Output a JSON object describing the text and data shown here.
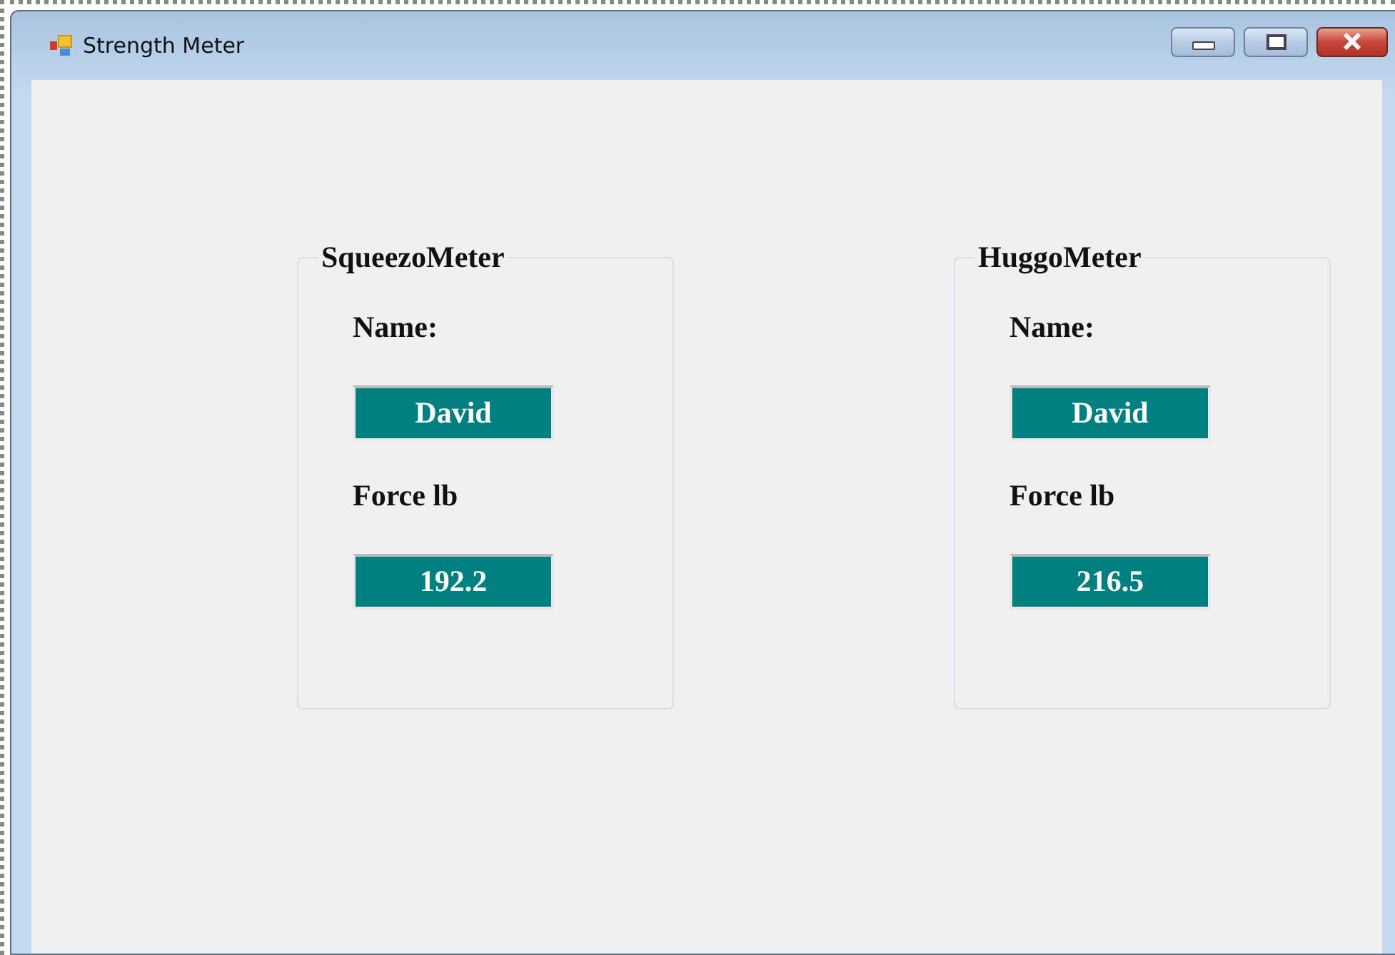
{
  "window": {
    "title": "Strength Meter"
  },
  "groups": [
    {
      "title": "SqueezoMeter",
      "name_label": "Name:",
      "name_value": "David",
      "force_label": "Force lb",
      "force_value": "192.2"
    },
    {
      "title": "HuggoMeter",
      "name_label": "Name:",
      "name_value": "David",
      "force_label": "Force lb",
      "force_value": "216.5"
    }
  ]
}
